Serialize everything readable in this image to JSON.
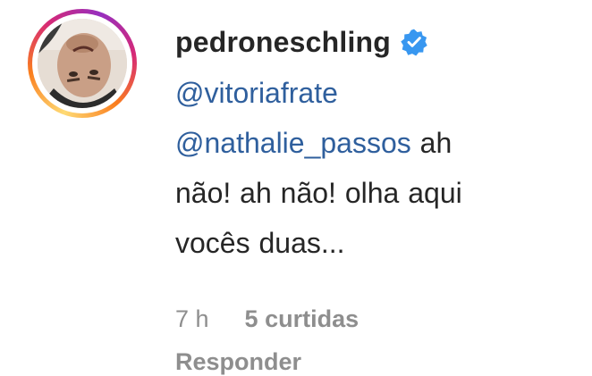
{
  "comment": {
    "username": "pedroneschling",
    "verified_icon": "verified-badge-icon",
    "avatar_icon": "profile-photo",
    "mention_1": "@vitoriafrate",
    "mention_2": "@nathalie_passos",
    "text_line_1_rest": " ah",
    "text_line_2": "não! ah não! olha aqui",
    "text_line_3": "vocês duas...",
    "time": "7 h",
    "likes": "5 curtidas",
    "reply_label": "Responder"
  },
  "colors": {
    "mention": "#2f5f9d",
    "verified": "#3897f0",
    "meta": "#8e8e8e",
    "text": "#262626"
  }
}
